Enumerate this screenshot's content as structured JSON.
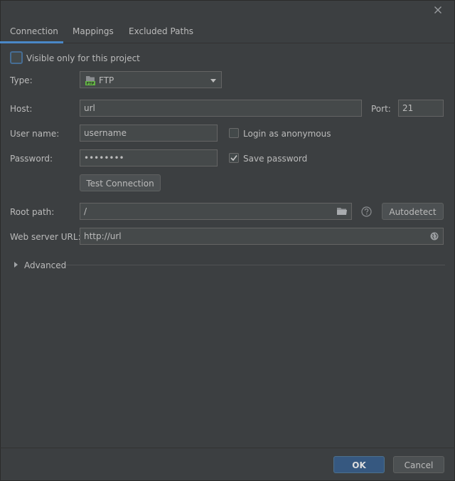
{
  "tabs": [
    {
      "label": "Connection",
      "selected": true
    },
    {
      "label": "Mappings"
    },
    {
      "label": "Excluded Paths"
    }
  ],
  "visible_only": {
    "label": "Visible only for this project",
    "checked": false
  },
  "type": {
    "label": "Type:",
    "value": "FTP"
  },
  "host": {
    "label": "Host:",
    "value": "url",
    "port_label": "Port:",
    "port_value": "21"
  },
  "username": {
    "label": "User name:",
    "value": "username",
    "anonymous_label": "Login as anonymous",
    "anonymous_checked": false
  },
  "password": {
    "label": "Password:",
    "value": "••••••••",
    "save_label": "Save password",
    "save_checked": true
  },
  "test_connection_label": "Test Connection",
  "root_path": {
    "label": "Root path:",
    "value": "/",
    "autodetect_label": "Autodetect"
  },
  "web_url": {
    "label": "Web server URL:",
    "value": "http://url"
  },
  "advanced_label": "Advanced",
  "footer": {
    "ok_label": "OK",
    "cancel_label": "Cancel"
  },
  "colors": {
    "accent": "#4a88c7",
    "background": "#3c3f41",
    "ok_button": "#365880",
    "ftp_icon": "#62b543"
  }
}
